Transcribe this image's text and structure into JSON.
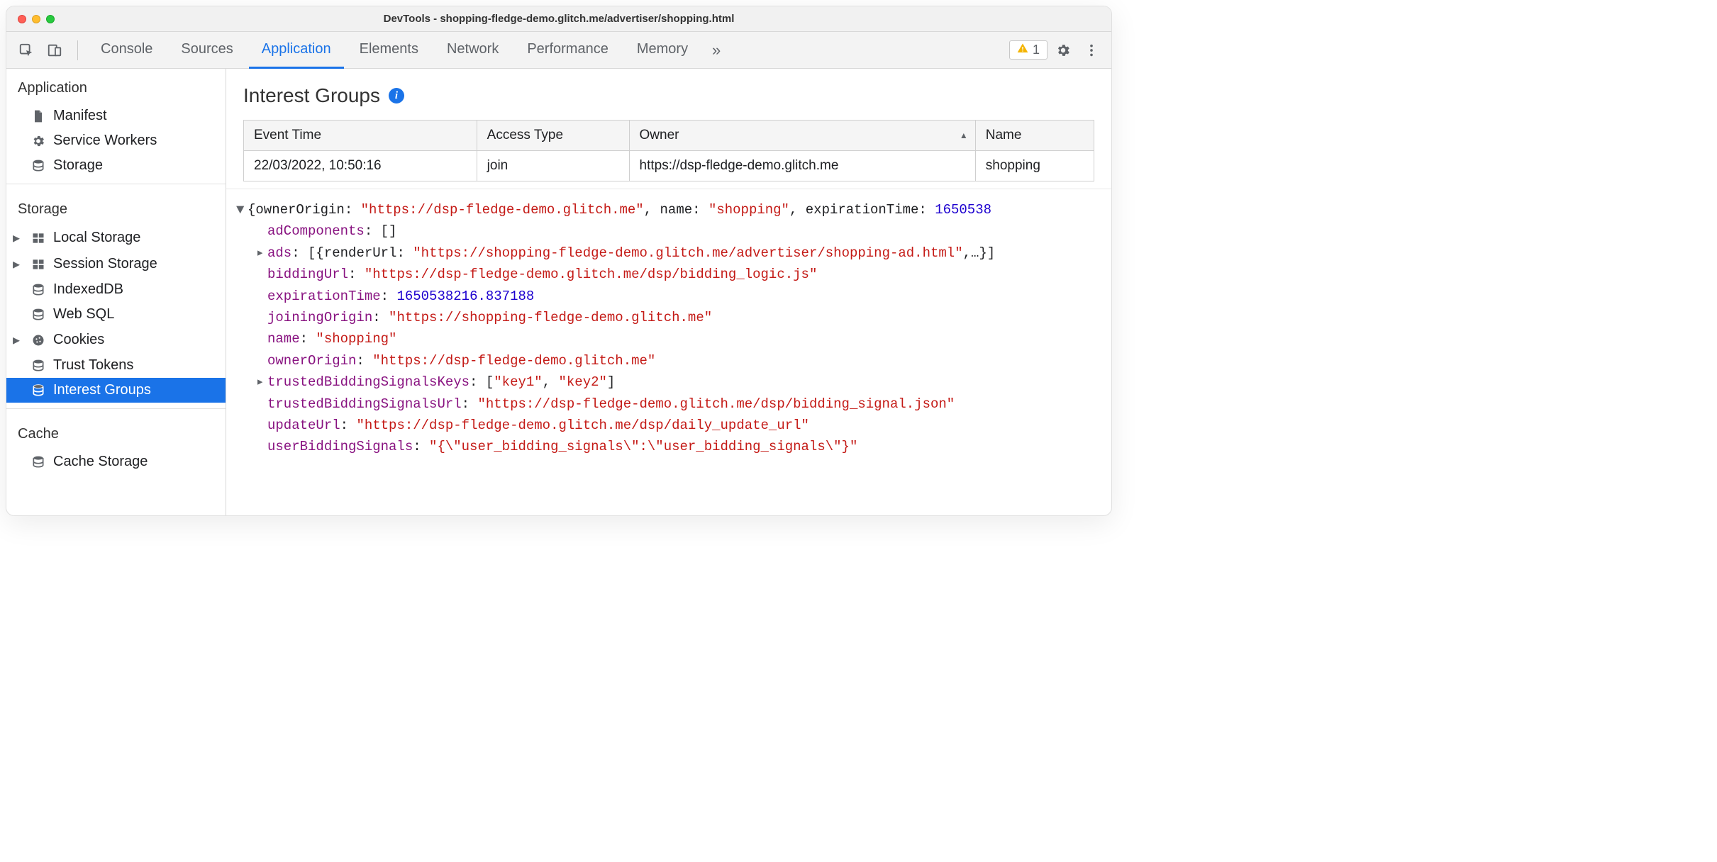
{
  "window": {
    "title": "DevTools - shopping-fledge-demo.glitch.me/advertiser/shopping.html"
  },
  "toolbar": {
    "tabs": [
      "Console",
      "Sources",
      "Application",
      "Elements",
      "Network",
      "Performance",
      "Memory"
    ],
    "active_tab_index": 2,
    "warn_count": "1"
  },
  "sidebar": {
    "sections": [
      {
        "title": "Application",
        "items": [
          {
            "icon": "manifest",
            "caret": "",
            "label": "Manifest"
          },
          {
            "icon": "gear",
            "caret": "",
            "label": "Service Workers"
          },
          {
            "icon": "db",
            "caret": "",
            "label": "Storage"
          }
        ]
      },
      {
        "title": "Storage",
        "items": [
          {
            "icon": "grid",
            "caret": "▸",
            "label": "Local Storage"
          },
          {
            "icon": "grid",
            "caret": "▸",
            "label": "Session Storage"
          },
          {
            "icon": "db",
            "caret": "",
            "label": "IndexedDB"
          },
          {
            "icon": "db",
            "caret": "",
            "label": "Web SQL"
          },
          {
            "icon": "cookie",
            "caret": "▸",
            "label": "Cookies"
          },
          {
            "icon": "db",
            "caret": "",
            "label": "Trust Tokens"
          },
          {
            "icon": "db",
            "caret": "",
            "label": "Interest Groups",
            "selected": true
          }
        ]
      },
      {
        "title": "Cache",
        "items": [
          {
            "icon": "db",
            "caret": "",
            "label": "Cache Storage"
          }
        ]
      }
    ]
  },
  "main": {
    "header": "Interest Groups",
    "table": {
      "headers": [
        "Event Time",
        "Access Type",
        "Owner",
        "Name"
      ],
      "sort_col": 2,
      "rows": [
        [
          "22/03/2022, 10:50:16",
          "join",
          "https://dsp-fledge-demo.glitch.me",
          "shopping"
        ]
      ]
    },
    "details": {
      "summary_prefix": "{ownerOrigin: ",
      "summary_owner": "\"https://dsp-fledge-demo.glitch.me\"",
      "summary_mid": ", name: ",
      "summary_name": "\"shopping\"",
      "summary_mid2": ", expirationTime: ",
      "summary_exp": "1650538",
      "adComponents_key": "adComponents",
      "adComponents_val": "[]",
      "ads_key": "ads",
      "ads_val_prefix": "[{renderUrl: ",
      "ads_val_url": "\"https://shopping-fledge-demo.glitch.me/advertiser/shopping-ad.html\"",
      "ads_val_suffix": ",…}]",
      "biddingUrl_key": "biddingUrl",
      "biddingUrl_val": "\"https://dsp-fledge-demo.glitch.me/dsp/bidding_logic.js\"",
      "expirationTime_key": "expirationTime",
      "expirationTime_val": "1650538216.837188",
      "joiningOrigin_key": "joiningOrigin",
      "joiningOrigin_val": "\"https://shopping-fledge-demo.glitch.me\"",
      "name_key": "name",
      "name_val": "\"shopping\"",
      "ownerOrigin_key": "ownerOrigin",
      "ownerOrigin_val": "\"https://dsp-fledge-demo.glitch.me\"",
      "tbsk_key": "trustedBiddingSignalsKeys",
      "tbsk_val_open": "[",
      "tbsk_val_k1": "\"key1\"",
      "tbsk_val_sep": ", ",
      "tbsk_val_k2": "\"key2\"",
      "tbsk_val_close": "]",
      "tbsu_key": "trustedBiddingSignalsUrl",
      "tbsu_val": "\"https://dsp-fledge-demo.glitch.me/dsp/bidding_signal.json\"",
      "updateUrl_key": "updateUrl",
      "updateUrl_val": "\"https://dsp-fledge-demo.glitch.me/dsp/daily_update_url\"",
      "ubs_key": "userBiddingSignals",
      "ubs_val": "\"{\\\"user_bidding_signals\\\":\\\"user_bidding_signals\\\"}\""
    }
  }
}
